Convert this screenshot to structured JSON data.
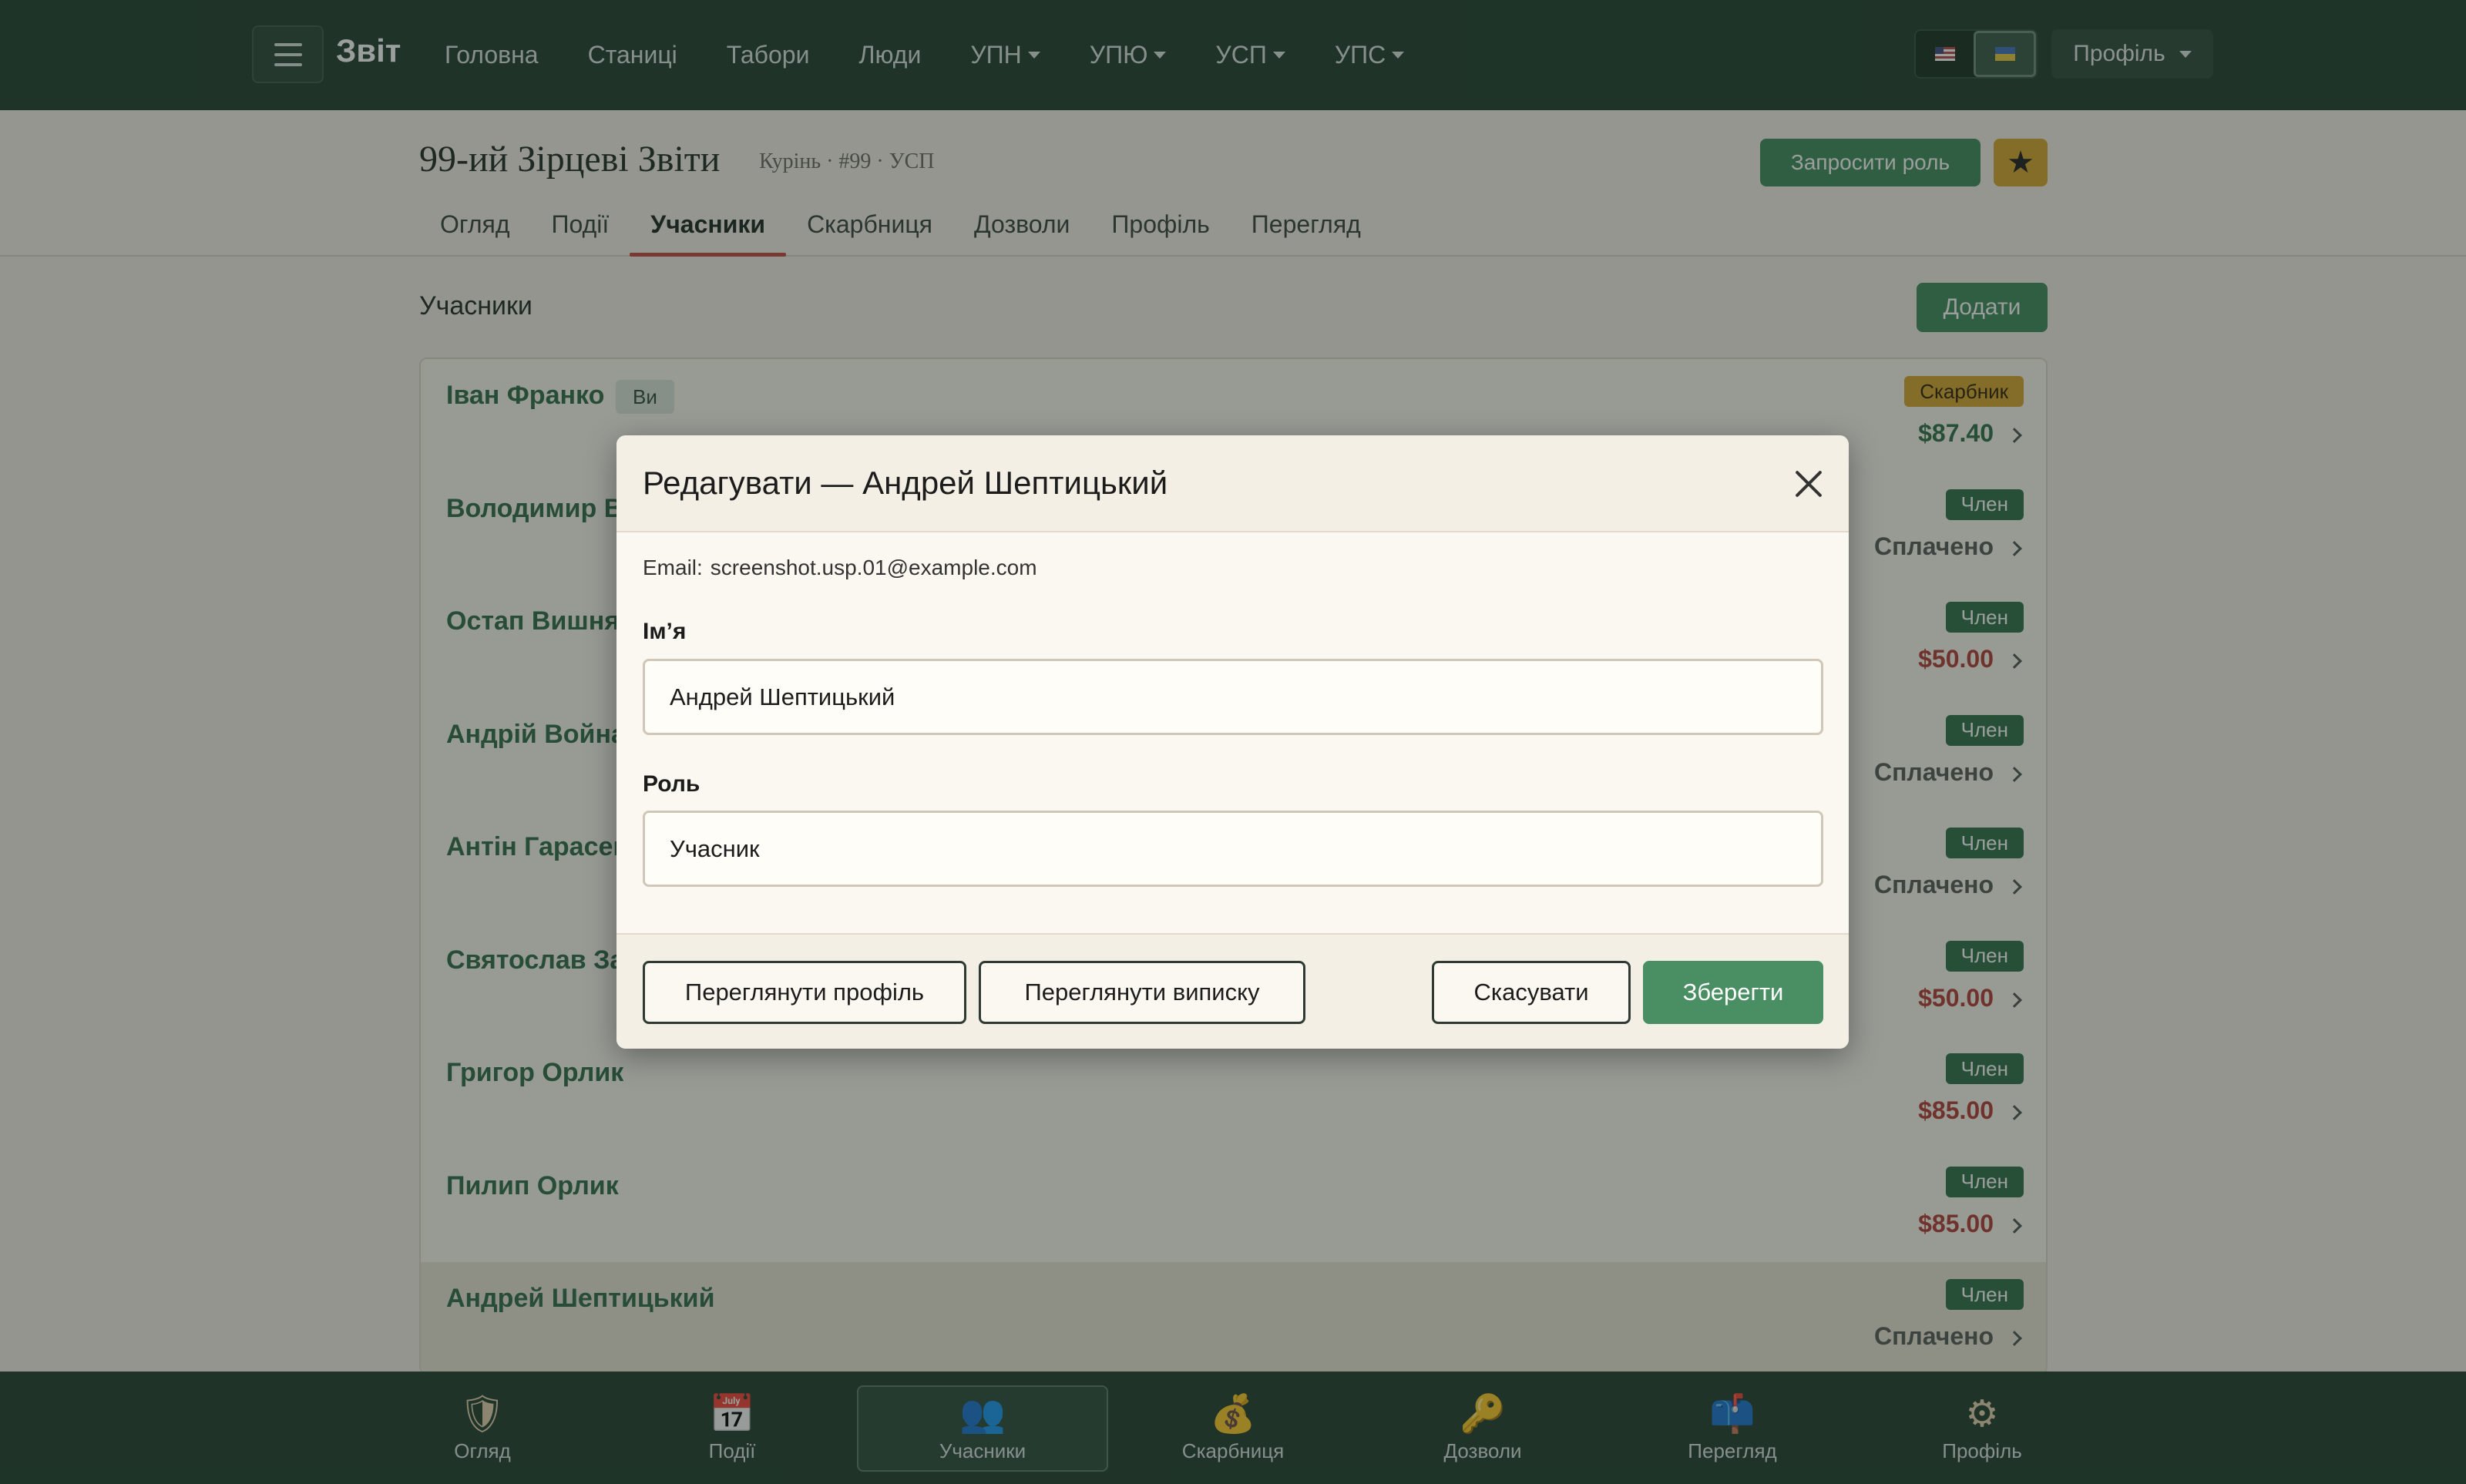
{
  "navbar": {
    "brand": "Звіт",
    "links": [
      {
        "label": "Головна",
        "dropdown": false
      },
      {
        "label": "Станиці",
        "dropdown": false
      },
      {
        "label": "Табори",
        "dropdown": false
      },
      {
        "label": "Люди",
        "dropdown": false
      },
      {
        "label": "УПН",
        "dropdown": true
      },
      {
        "label": "УПЮ",
        "dropdown": true
      },
      {
        "label": "УСП",
        "dropdown": true
      },
      {
        "label": "УПС",
        "dropdown": true
      }
    ],
    "profile_label": "Профіль",
    "languages": [
      "flag-us-icon",
      "flag-ua-icon"
    ],
    "active_language": "flag-ua-icon"
  },
  "header": {
    "title": "99-ий Зірцеві Звіти",
    "subtitle": "Курінь · #99 · УСП",
    "invite_label": "Запросити роль",
    "tabs": [
      "Огляд",
      "Події",
      "Учасники",
      "Скарбниця",
      "Дозволи",
      "Профіль",
      "Перегляд"
    ],
    "active_tab": "Учасники"
  },
  "members_section": {
    "title": "Учасники",
    "add_label": "Додати",
    "members": [
      {
        "name": "Іван Франко",
        "you_badge": "Ви",
        "role": "Скарбник",
        "amount": "$87.40",
        "amount_type": "positive"
      },
      {
        "name": "Володимир Ве",
        "role": "Член",
        "amount": "Сплачено",
        "amount_type": "paid"
      },
      {
        "name": "Остап Вишня",
        "role": "Член",
        "amount": "$50.00",
        "amount_type": "negative"
      },
      {
        "name": "Андрій Войнар",
        "role": "Член",
        "amount": "Сплачено",
        "amount_type": "paid"
      },
      {
        "name": "Антін Гарасев",
        "role": "Член",
        "amount": "Сплачено",
        "amount_type": "paid"
      },
      {
        "name": "Святослав Зал",
        "role": "Член",
        "amount": "$50.00",
        "amount_type": "negative"
      },
      {
        "name": "Григор Орлик",
        "role": "Член",
        "amount": "$85.00",
        "amount_type": "negative"
      },
      {
        "name": "Пилип Орлик",
        "role": "Член",
        "amount": "$85.00",
        "amount_type": "negative"
      },
      {
        "name": "Андрей Шептицький",
        "role": "Член",
        "amount": "Сплачено",
        "amount_type": "paid",
        "highlight": true
      }
    ]
  },
  "bottom_nav": [
    {
      "label": "Огляд",
      "icon": "shield-icon",
      "glyph": "🛡"
    },
    {
      "label": "Події",
      "icon": "calendar-icon",
      "glyph": "📅"
    },
    {
      "label": "Учасники",
      "icon": "people-icon",
      "glyph": "👥",
      "active": true
    },
    {
      "label": "Скарбниця",
      "icon": "money-bag-icon",
      "glyph": "💰"
    },
    {
      "label": "Дозволи",
      "icon": "key-icon",
      "glyph": "🔑"
    },
    {
      "label": "Перегляд",
      "icon": "mailbox-icon",
      "glyph": "📫"
    },
    {
      "label": "Профіль",
      "icon": "gear-icon",
      "glyph": "⚙"
    }
  ],
  "modal": {
    "title": "Редагувати — Андрей Шептицький",
    "email_label": "Email:",
    "email_value": "screenshot.usp.01@example.com",
    "name_label": "Ім’я",
    "name_value": "Андрей Шептицький",
    "role_label": "Роль",
    "role_value": "Учасник",
    "view_profile_label": "Переглянути профіль",
    "view_statement_label": "Переглянути виписку",
    "cancel_label": "Скасувати",
    "save_label": "Зберегти"
  },
  "colors": {
    "navbar": "#1f3d2e",
    "accent_green": "#3f8a5b",
    "treasurer_badge": "#d8a72d",
    "amount_negative": "#b33b34",
    "amount_positive": "#2f7048",
    "active_tab_underline": "#c0473d"
  }
}
